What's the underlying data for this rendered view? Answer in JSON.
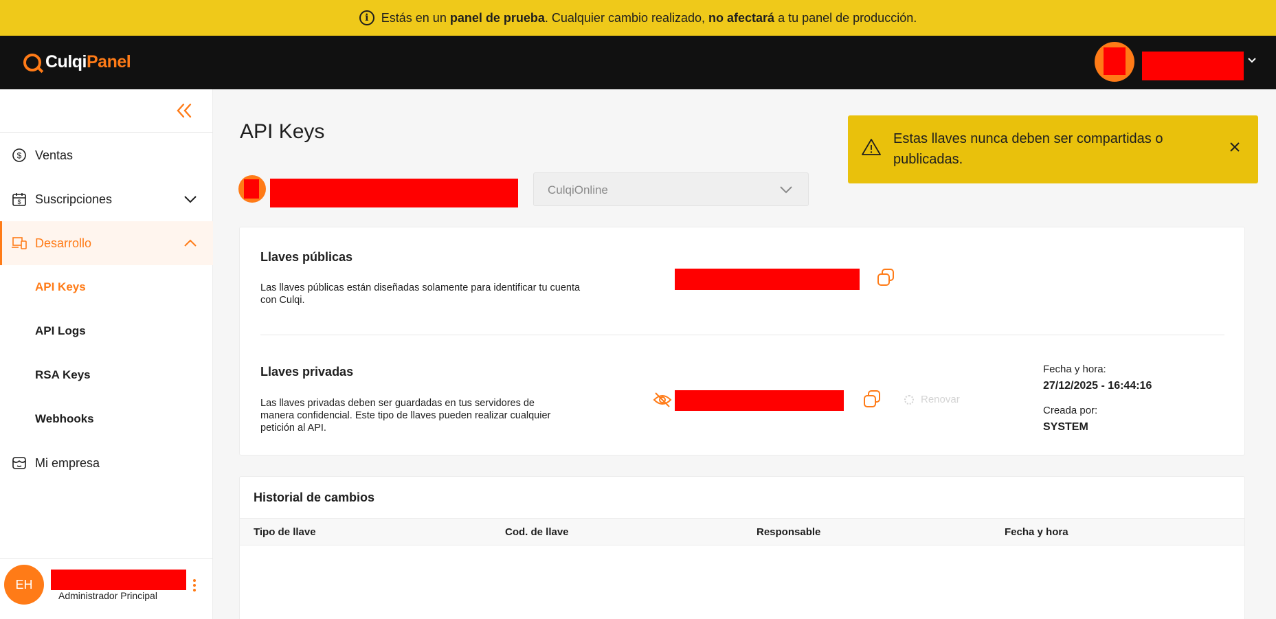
{
  "banner": {
    "prefix": "Estás en un ",
    "bold1": "panel de prueba",
    "mid": ". Cualquier cambio realizado, ",
    "bold2": "no afectará",
    "suffix": " a tu panel de producción."
  },
  "brand": {
    "part1": "Culqi",
    "part2": "Panel",
    "accent": "#ff7b17"
  },
  "sidebar": {
    "items": [
      {
        "label": "Ventas",
        "icon": "dollar-circle-icon"
      },
      {
        "label": "Suscripciones",
        "icon": "calendar-dollar-icon"
      },
      {
        "label": "Desarrollo",
        "icon": "devices-icon"
      },
      {
        "label": "Mi empresa",
        "icon": "store-icon"
      }
    ],
    "subitems": [
      {
        "label": "API Keys"
      },
      {
        "label": "API Logs"
      },
      {
        "label": "RSA Keys"
      },
      {
        "label": "Webhooks"
      }
    ]
  },
  "user": {
    "initials": "EH",
    "role": "Administrador Principal"
  },
  "main": {
    "title": "API Keys",
    "alert": {
      "message": "Estas llaves nunca deben ser compartidas o publicadas.",
      "close": "×"
    },
    "select": {
      "value": "CulqiOnline"
    },
    "public_keys": {
      "title": "Llaves públicas",
      "description": "Las llaves públicas están diseñadas solamente para identificar tu cuenta con Culqi."
    },
    "private_keys": {
      "title": "Llaves privadas",
      "description": "Las llaves privadas deben ser guardadas en tus servidores de manera confidencial. Este tipo de llaves pueden realizar cualquier petición al API.",
      "renew": "Renovar",
      "date_label": "Fecha y hora:",
      "date_value": "27/12/2025 - 16:44:16",
      "created_label": "Creada por:",
      "created_value": "SYSTEM"
    },
    "history": {
      "title": "Historial de cambios",
      "columns": [
        "Tipo de llave",
        "Cod. de llave",
        "Responsable",
        "Fecha y hora"
      ]
    }
  }
}
